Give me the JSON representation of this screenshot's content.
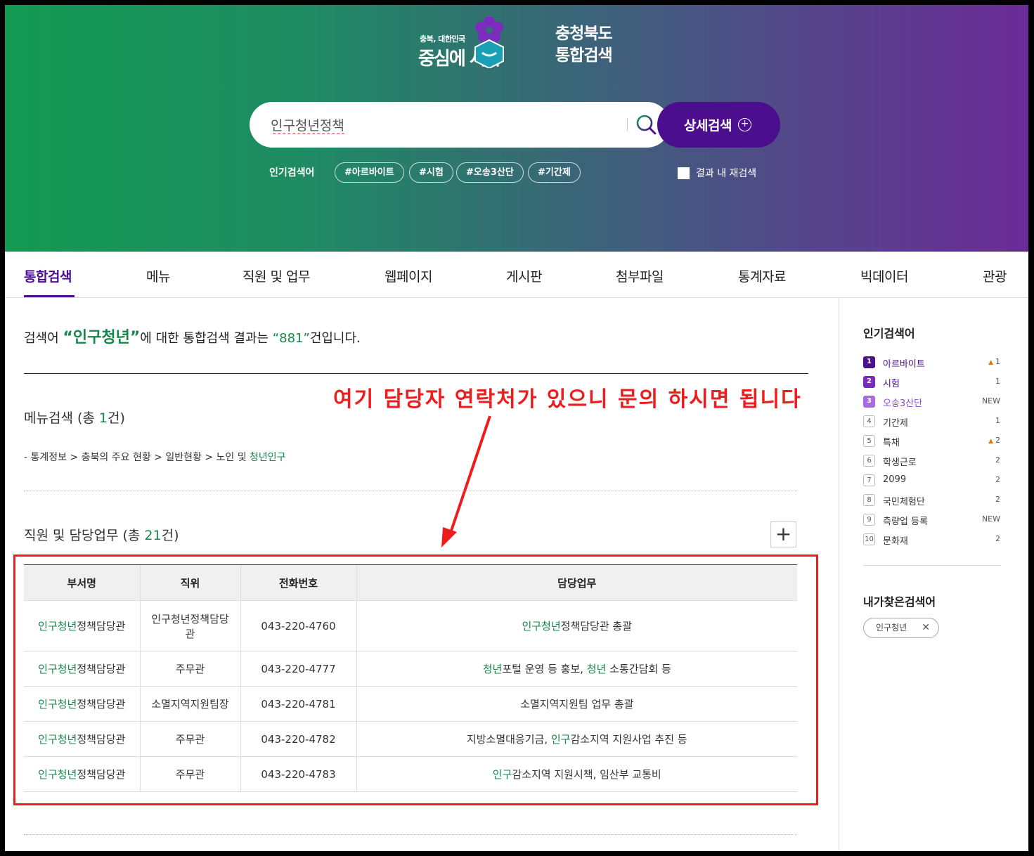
{
  "header": {
    "slogan_small": "충북, 대한민국",
    "slogan_big": "중심에 서다",
    "site_name_line1": "충청북도",
    "site_name_line2": "통합검색",
    "search_value": "인구청년정책",
    "advanced_search_label": "상세검색",
    "popular_label": "인기검색어",
    "popular_tags": [
      "#아르바이트",
      "#시험",
      "#오송3산단",
      "#기간제"
    ],
    "research_label": "결과 내 재검색"
  },
  "tabs": [
    "통합검색",
    "메뉴",
    "직원 및 업무",
    "웹페이지",
    "게시판",
    "첨부파일",
    "통계자료",
    "빅데이터",
    "관광"
  ],
  "summary": {
    "prefix": "검색어 ",
    "keyword": "“인구청년”",
    "middle": "에 대한 통합검색 결과는 ",
    "count": "“881”",
    "suffix": "건입니다."
  },
  "annotation": "여기 담당자 연락처가 있으니 문의 하시면 됩니다",
  "menu_section": {
    "title_prefix": "메뉴검색 (총 ",
    "count": "1",
    "title_suffix": "건)",
    "path_plain": "-  통계정보 > 충북의 주요 현황 > 일반현황 > 노인 및 ",
    "path_highlight": "청년인구"
  },
  "staff_section": {
    "title_prefix": "직원 및 담당업무 (총 ",
    "count": "21",
    "title_suffix": "건)",
    "expand_label": "+",
    "headers": [
      "부서명",
      "직위",
      "전화번호",
      "담당업무"
    ],
    "rows": [
      {
        "dept_hl": "인구청년",
        "dept_rest": "정책담당관",
        "position": "인구청년정책담당관",
        "phone": "043-220-4760",
        "duty": [
          {
            "t": "인구청년",
            "hl": true
          },
          {
            "t": "정책담당관 총괄",
            "hl": false
          }
        ]
      },
      {
        "dept_hl": "인구청년",
        "dept_rest": "정책담당관",
        "position": "주무관",
        "phone": "043-220-4777",
        "duty": [
          {
            "t": "청년",
            "hl": true
          },
          {
            "t": "포털 운영 등 홍보, ",
            "hl": false
          },
          {
            "t": "청년",
            "hl": true
          },
          {
            "t": " 소통간담회 등",
            "hl": false
          }
        ]
      },
      {
        "dept_hl": "인구청년",
        "dept_rest": "정책담당관",
        "position": "소멸지역지원팀장",
        "phone": "043-220-4781",
        "duty": [
          {
            "t": "소멸지역지원팀 업무 총괄",
            "hl": false
          }
        ]
      },
      {
        "dept_hl": "인구청년",
        "dept_rest": "정책담당관",
        "position": "주무관",
        "phone": "043-220-4782",
        "duty": [
          {
            "t": "지방소멸대응기금, ",
            "hl": false
          },
          {
            "t": "인구",
            "hl": true
          },
          {
            "t": "감소지역 지원사업 추진 등",
            "hl": false
          }
        ]
      },
      {
        "dept_hl": "인구청년",
        "dept_rest": "정책담당관",
        "position": "주무관",
        "phone": "043-220-4783",
        "duty": [
          {
            "t": "인구",
            "hl": true
          },
          {
            "t": "감소지역 지원시책, 임산부 교통비",
            "hl": false
          }
        ]
      }
    ]
  },
  "sidebar": {
    "popular_title": "인기검색어",
    "ranks": [
      {
        "n": "1",
        "word": "아르바이트",
        "change": "1",
        "up": true
      },
      {
        "n": "2",
        "word": "시험",
        "change": "1",
        "up": false
      },
      {
        "n": "3",
        "word": "오송3산단",
        "change": "NEW",
        "up": false
      },
      {
        "n": "4",
        "word": "기간제",
        "change": "1",
        "up": false
      },
      {
        "n": "5",
        "word": "특채",
        "change": "2",
        "up": true
      },
      {
        "n": "6",
        "word": "학생근로",
        "change": "2",
        "up": false
      },
      {
        "n": "7",
        "word": "2099",
        "change": "2",
        "up": false
      },
      {
        "n": "8",
        "word": "국민체험단",
        "change": "2",
        "up": false
      },
      {
        "n": "9",
        "word": "측량업 등록",
        "change": "NEW",
        "up": false
      },
      {
        "n": "10",
        "word": "문화재",
        "change": "2",
        "up": false
      }
    ],
    "my_title": "내가찾은검색어",
    "my_chip": "인구청년",
    "my_chip_close": "✕"
  },
  "colors": {
    "accent_purple": "#4a0e8f",
    "highlight_green": "#16874a",
    "annotation_red": "#ee1c1c"
  }
}
